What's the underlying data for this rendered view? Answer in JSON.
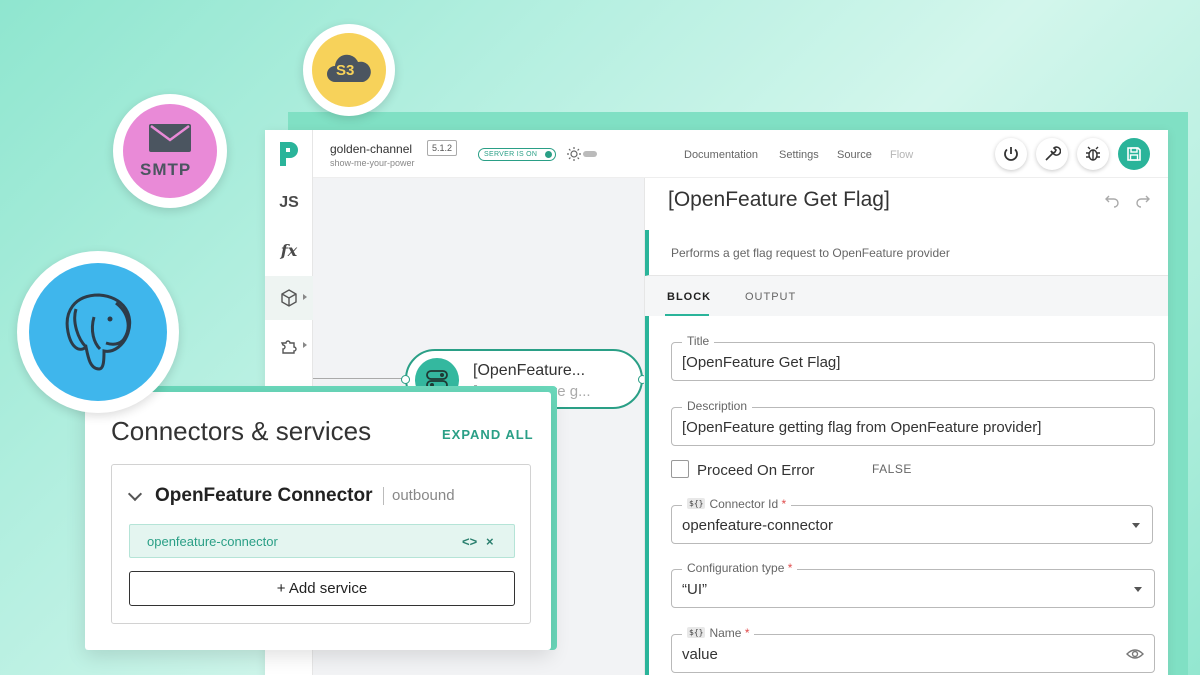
{
  "badges": {
    "s3_label": "S3",
    "smtp_label": "SMTP",
    "postgres_icon": "postgres-elephant-icon"
  },
  "header": {
    "channel_name": "golden-channel",
    "channel_sub": "show-me-your-power",
    "version": "5.1.2",
    "server_status": "SERVER IS ON",
    "nav": [
      "Documentation",
      "Settings",
      "Source",
      "Flow"
    ]
  },
  "rail": {
    "items": [
      "JS",
      "fx"
    ]
  },
  "node": {
    "title": "[OpenFeature...",
    "subtitle": "[OpenFeature g..."
  },
  "panel": {
    "title": "[OpenFeature Get Flag]",
    "description": "Performs a get flag request to OpenFeature provider",
    "tabs": [
      "BLOCK",
      "OUTPUT"
    ],
    "fields": {
      "title_label": "Title",
      "title_value": "[OpenFeature Get Flag]",
      "description_label": "Description",
      "description_value": "[OpenFeature getting flag from OpenFeature provider]",
      "proceed_label": "Proceed On Error",
      "proceed_value": "FALSE",
      "connector_label": "Connector Id",
      "connector_value": "openfeature-connector",
      "config_label": "Configuration type",
      "config_value": "“UI”",
      "name_label": "Name",
      "name_value": "value",
      "template_tag": "${}",
      "required_mark": "*"
    }
  },
  "connectors": {
    "title": "Connectors & services",
    "expand_all": "EXPAND ALL",
    "connector_name": "OpenFeature Connector",
    "connector_direction": "outbound",
    "service_chip": "openfeature-connector",
    "code_icon": "<>",
    "remove_icon": "×",
    "add_service": "+ Add service"
  },
  "colors": {
    "accent": "#2ab49a",
    "s3": "#f7d25a",
    "smtp": "#e98ad7",
    "postgres": "#3fb6ec"
  }
}
